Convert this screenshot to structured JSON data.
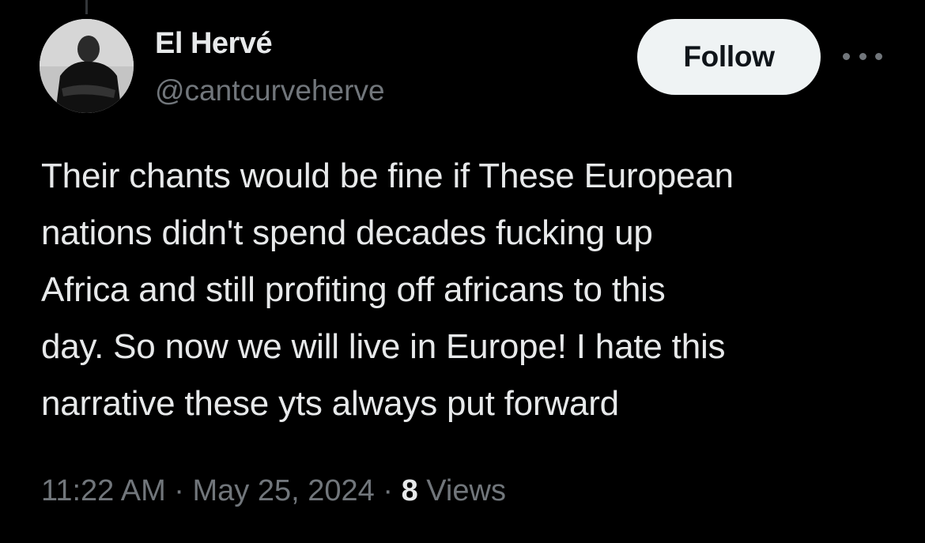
{
  "colors": {
    "background": "#000000",
    "primary_text": "#e7e9ea",
    "secondary_text": "#71767b",
    "follow_button_bg": "#eff3f4",
    "follow_button_text": "#0f1419"
  },
  "author": {
    "display_name": "El Hervé",
    "handle": "@cantcurveherve",
    "avatar_icon": "profile-photo"
  },
  "actions": {
    "follow_label": "Follow",
    "more_icon": "more-horizontal-icon"
  },
  "tweet": {
    "text": "Their chants would be fine if These European\nnations didn't spend decades fucking up\nAfrica and still profiting off africans to this\nday. So now we will live in Europe! I hate this\nnarrative these yts always put forward",
    "time": "11:22 AM",
    "separator": "·",
    "date": "May 25, 2024",
    "views_count": "8",
    "views_label": "Views"
  }
}
